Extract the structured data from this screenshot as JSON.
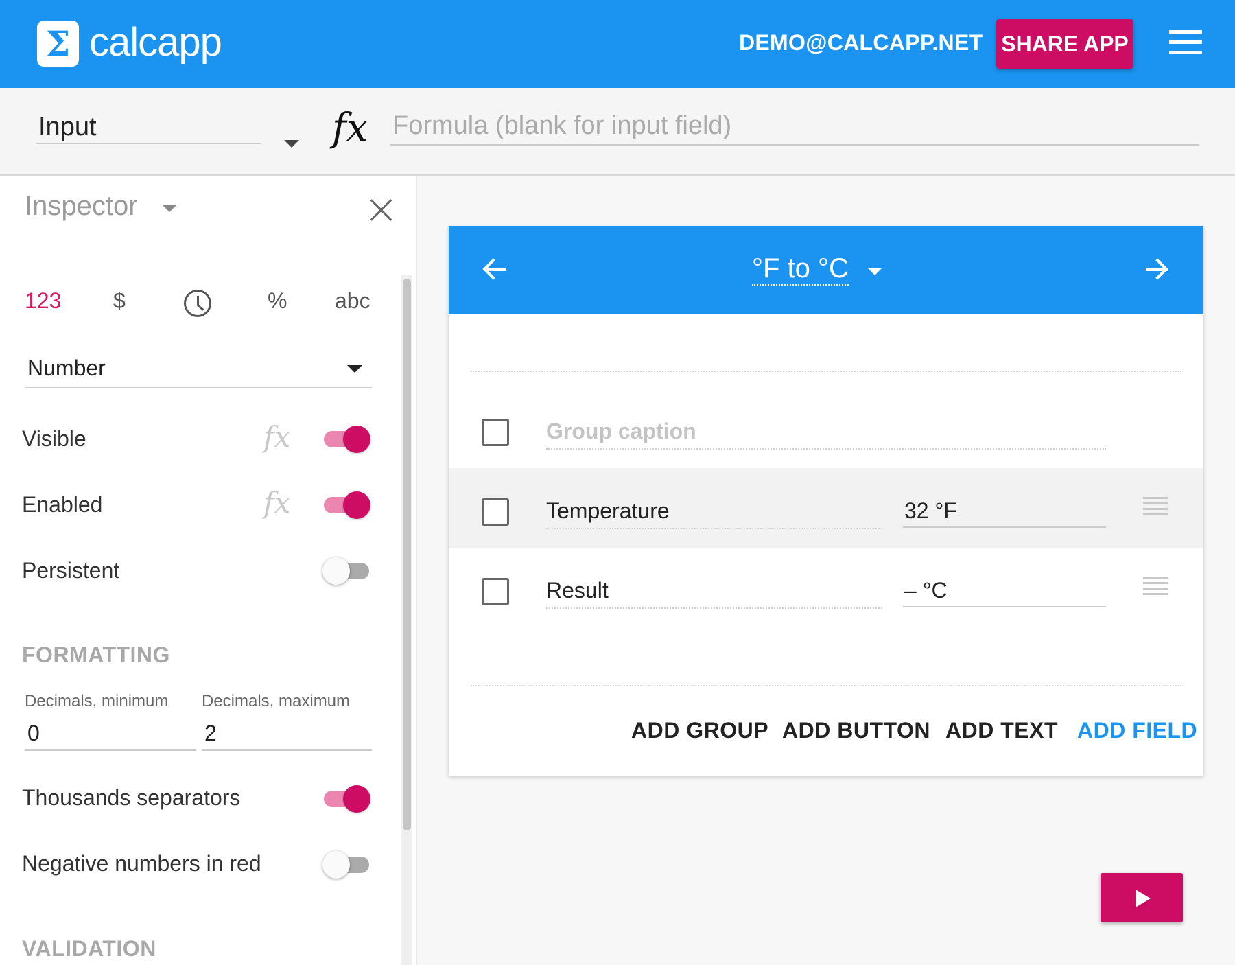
{
  "header": {
    "logo_symbol": "Σ",
    "app_name": "calcapp",
    "user_email": "DEMO@CALCAPP.NET",
    "share_label": "SHARE APP",
    "brand_color": "#1a94f0",
    "accent_color": "#cc0d63"
  },
  "formula_bar": {
    "field_type": "Input",
    "fx_symbol": "fx",
    "formula_placeholder": "Formula (blank for input field)"
  },
  "inspector": {
    "title": "Inspector",
    "format_tabs": [
      {
        "label": "123",
        "active": true
      },
      {
        "label": "$",
        "active": false
      },
      {
        "icon": "clock-icon",
        "active": false
      },
      {
        "label": "%",
        "active": false
      },
      {
        "label": "abc",
        "active": false
      }
    ],
    "number_type": "Number",
    "fx_symbol": "fx",
    "toggles": {
      "visible": {
        "label": "Visible",
        "on": true
      },
      "enabled": {
        "label": "Enabled",
        "on": true
      },
      "persistent": {
        "label": "Persistent",
        "on": false
      },
      "thousands": {
        "label": "Thousands separators",
        "on": true
      },
      "negative_red": {
        "label": "Negative numbers in red",
        "on": false
      }
    },
    "formatting_heading": "FORMATTING",
    "decimals_min_label": "Decimals, minimum",
    "decimals_min_value": "0",
    "decimals_max_label": "Decimals, maximum",
    "decimals_max_value": "2",
    "validation_heading": "VALIDATION"
  },
  "app_card": {
    "page_title": "°F to °C",
    "group_caption_placeholder": "Group caption",
    "fields": [
      {
        "label": "Temperature",
        "value": "32 °F",
        "selected": true
      },
      {
        "label": "Result",
        "value": "– °C",
        "selected": false
      }
    ],
    "actions": {
      "add_group": "ADD GROUP",
      "add_button": "ADD BUTTON",
      "add_text": "ADD TEXT",
      "add_field": "ADD FIELD"
    }
  }
}
